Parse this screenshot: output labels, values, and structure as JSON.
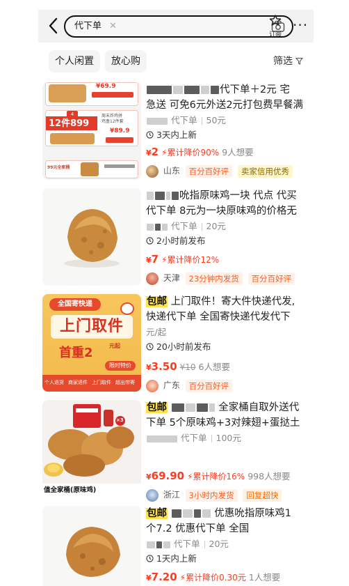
{
  "header": {
    "search_query": "代下单",
    "fav_label": "订阅",
    "more": "···"
  },
  "filters": {
    "items": [
      "个人闲置",
      "放心购"
    ],
    "sift_label": "筛选"
  },
  "listings": [
    {
      "thumb": {
        "row_count": "12件899",
        "row_price": "¥89.9",
        "row_caption": "周末炸鸡拼\n鸡盒12件套",
        "top_price": "¥69.9",
        "bottom_label": "99元全家桶",
        "top_badge": "4"
      },
      "title_lines": [
        "代下单＋2元 宅",
        "急送 可免6元外送2元打包费早餐满"
      ],
      "meta_left": "代下单",
      "meta_right": "50元",
      "time": "3天内上新",
      "price": "2",
      "currency": "¥",
      "drop": "累计降价90%",
      "want": "9人想要",
      "location": "山东",
      "badges": [
        "百分百好评",
        "卖家信用优秀"
      ],
      "badge_colors": [
        "#fff0e8",
        "#fff7cc"
      ]
    },
    {
      "title_lines": [
        "吮指原味鸡一块 代点 代买",
        "代下单 8元为一块原味鸡的价格无"
      ],
      "meta_left": "代下单",
      "meta_right": "20元",
      "time": "2小时前发布",
      "price": "7",
      "currency": "¥",
      "drop": "累计降价12%",
      "want": "",
      "location": "天津",
      "badges": [
        "23分钟内发货",
        "百分百好评"
      ]
    },
    {
      "tag": "包邮",
      "thumb": {
        "line1": "全国寄快递",
        "line2": "上门取件",
        "line3": "首重2",
        "unit": "元起",
        "btn": "限时特价",
        "footer": [
          "个人退货",
          "商家退件",
          "上门取件",
          "超出带寄"
        ]
      },
      "title_lines": [
        " 上门取件！寄大件快递代发,",
        "快递代下单 全国寄快递代发代下"
      ],
      "meta_left": "元/起",
      "meta_right": "",
      "time": "20小时前发布",
      "price": "3.50",
      "currency": "¥",
      "orig": "¥10",
      "drop": "",
      "want": "6人想要",
      "location": "广东",
      "badges": [
        "百分百好评"
      ]
    },
    {
      "tag": "包邮",
      "thumb": {
        "caption": "值全家桶(原味鸡)",
        "qty": "×3"
      },
      "title_lines": [
        " 全家桶自取外送代",
        "下单 5个原味鸡+3对辣翅+蛋挞土"
      ],
      "meta_left": "代下单",
      "meta_right": "100元",
      "time": "",
      "price": "69.90",
      "currency": "¥",
      "drop": "累计降价16%",
      "want": "998人想要",
      "location": "浙江",
      "badges": [
        "3小时内发货",
        "回复超快"
      ]
    },
    {
      "tag": "包邮",
      "title_lines": [
        " 优惠吮指原味鸡1",
        "个7.2 优惠代下单 全国"
      ],
      "meta_left": "代下单",
      "meta_right": "20元",
      "time": "1天内上新",
      "price": "7.20",
      "currency": "¥",
      "drop": "累计降价0.30元",
      "want": "1人想要"
    }
  ],
  "colors": {
    "accent": "#ff3a1e",
    "highlight": "#ffe14d"
  }
}
